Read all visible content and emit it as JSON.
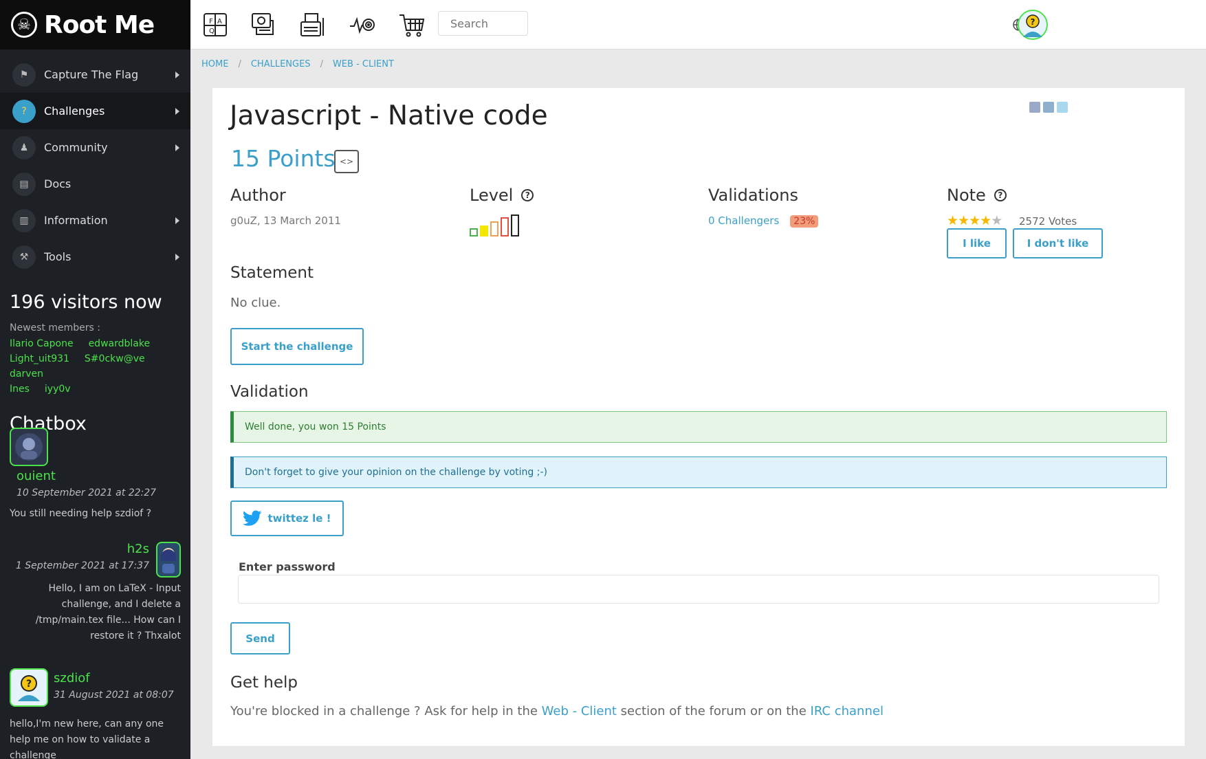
{
  "brand": "Root Me",
  "sidebar": {
    "items": [
      {
        "label": "Capture The Flag",
        "icon": "flag-icon"
      },
      {
        "label": "Challenges",
        "icon": "challenge-icon"
      },
      {
        "label": "Community",
        "icon": "community-icon"
      },
      {
        "label": "Docs",
        "icon": "docs-icon"
      },
      {
        "label": "Information",
        "icon": "information-icon"
      },
      {
        "label": "Tools",
        "icon": "tools-icon"
      }
    ],
    "visitors": "196 visitors now",
    "newest_label": "Newest members :",
    "members": [
      "Ilario Capone",
      "edwardblake",
      "Light_uit931",
      "S#0ckw@ve",
      "darven",
      "Ines",
      "iyy0v"
    ],
    "chatbox_title": "Chatbox",
    "messages": [
      {
        "user": "ouient",
        "date": "10 September 2021 at 22:27",
        "text": "You still needing help szdiof ?"
      },
      {
        "user": "h2s",
        "date": "1 September 2021 at 17:37",
        "text": "Hello, I am on LaTeX - Input challenge, and I delete a /tmp/main.tex file... How can I restore it ? Thxalot"
      },
      {
        "user": "szdiof",
        "date": "31 August 2021 at 08:07",
        "text": "hello,I'm new here, can any one help me on how to validate a challenge"
      }
    ]
  },
  "topbar": {
    "icons": [
      "faq-icon",
      "news-icon",
      "printer-icon",
      "radar-icon",
      "shop-cart-icon"
    ],
    "search_placeholder": "Search"
  },
  "breadcrumb": [
    "HOME",
    "CHALLENGES",
    "WEB - CLIENT"
  ],
  "challenge": {
    "title": "Javascript - Native code",
    "points": "15 Points",
    "author_label": "Author",
    "author_value": "g0uZ,  13 March 2011",
    "level_label": "Level",
    "level": 1,
    "validations_label": "Validations",
    "validations_value": "0 Challengers",
    "validations_pct": "23%",
    "note_label": "Note",
    "rating": 4,
    "votes": "2572 Votes",
    "like_label": "I like",
    "dislike_label": "I don't like",
    "statement_label": "Statement",
    "statement_text": "No clue.",
    "start_label": "Start the challenge",
    "validation_label": "Validation",
    "success_msg": "Well done, you won 15 Points",
    "info_msg": "Don't forget to give your opinion on the challenge by voting ;-)",
    "tweet_label": "twittez le !",
    "password_label": "Enter password",
    "send_label": "Send",
    "help_label": "Get help",
    "help_prefix": "You're blocked in a challenge ? Ask for help in the ",
    "help_link1": "Web - Client",
    "help_mid": " section of the forum or on the ",
    "help_link2": "IRC channel"
  },
  "colors": {
    "accent": "#3a9fc9",
    "green": "#4ce24c",
    "sidebar": "#1d2025"
  }
}
